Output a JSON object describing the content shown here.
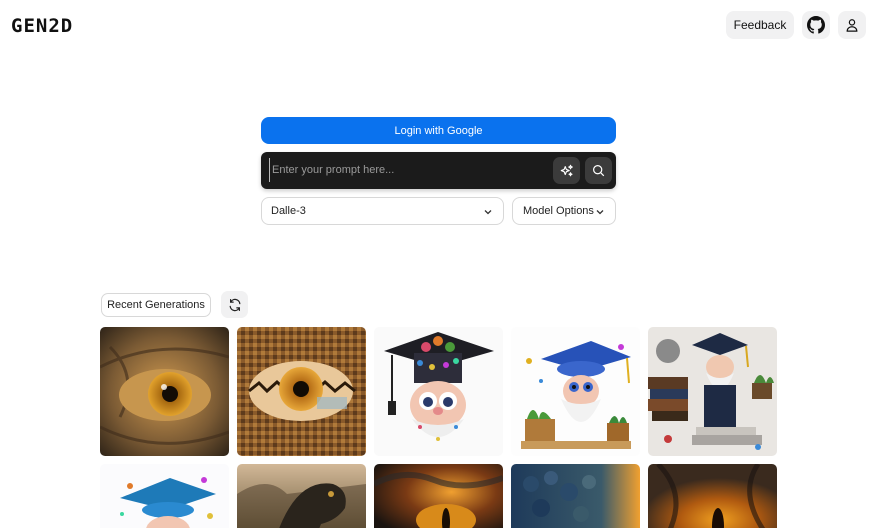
{
  "header": {
    "logo": "GEN2D",
    "feedback_label": "Feedback",
    "github_icon": "github-icon",
    "user_icon": "user-icon"
  },
  "main": {
    "login_label": "Login with Google",
    "prompt_placeholder": "Enter your prompt here...",
    "model_value": "Dalle-3",
    "model_options_label": "Model Options"
  },
  "recent": {
    "label": "Recent Generations",
    "images": [
      {
        "subject": "reptile eye close-up"
      },
      {
        "subject": "pixelated reptile eye"
      },
      {
        "subject": "graduation gnome with jewels"
      },
      {
        "subject": "graduation gnome with plants"
      },
      {
        "subject": "graduation gnome on books"
      },
      {
        "subject": "graduation gnome"
      },
      {
        "subject": "dinosaur at sunset"
      },
      {
        "subject": "reptile skin sunset"
      },
      {
        "subject": "reptile eye sunset"
      },
      {
        "subject": "reptile eye orange"
      }
    ]
  },
  "colors": {
    "accent": "#0a72ee",
    "prompt_bg": "#1b1b1b",
    "button_bg": "#f1f1f2"
  }
}
